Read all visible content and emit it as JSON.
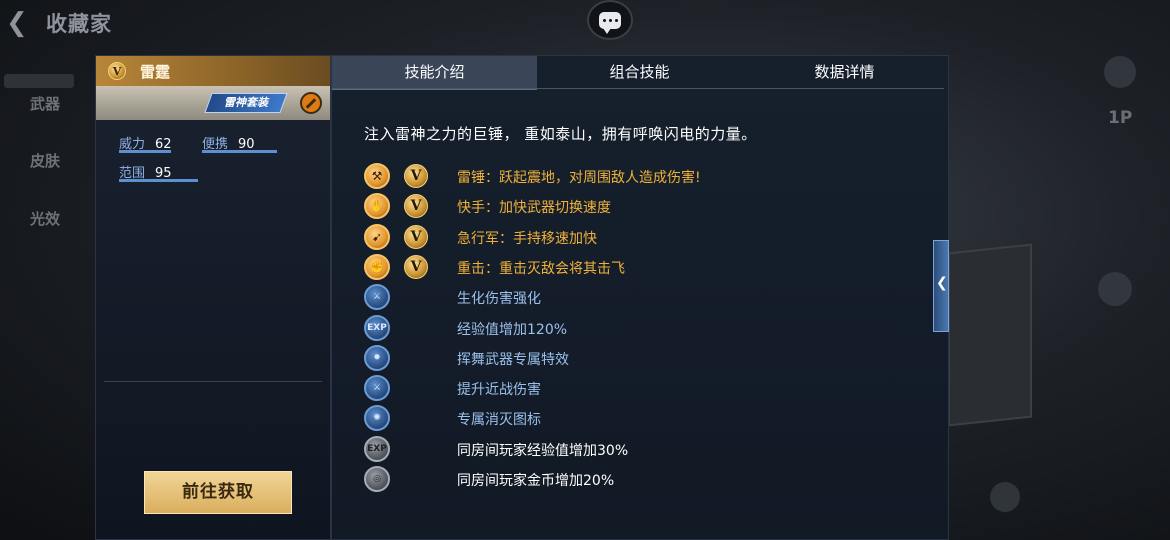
{
  "topbar": {
    "title": "收藏家",
    "back_icon": "chevron-left-icon",
    "chat_icon": "chat-bubble-icon"
  },
  "side_menu": [
    "武器",
    "皮肤",
    "光效"
  ],
  "right_hud": {
    "player_label": "1P"
  },
  "item": {
    "badge": "V",
    "name": "雷霆",
    "set_tag": "雷神套装",
    "stats": [
      {
        "label": "威力",
        "value": "62"
      },
      {
        "label": "便携",
        "value": "90"
      },
      {
        "label": "范围",
        "value": "95"
      }
    ],
    "get_button": "前往获取"
  },
  "tabs": [
    {
      "label": "技能介绍",
      "active": true
    },
    {
      "label": "组合技能",
      "active": false
    },
    {
      "label": "数据详情",
      "active": false
    }
  ],
  "description": "注入雷神之力的巨锤， 重如泰山，拥有呼唤闪电的力量。",
  "skills": [
    {
      "icon": "hammer-icon",
      "style": "gold",
      "v": "V",
      "text": "雷锤：跃起震地，对周围敌人造成伤害!",
      "color": "#f0b13a"
    },
    {
      "icon": "quick-hand-icon",
      "style": "gold",
      "v": "V",
      "text": "快手：加快武器切换速度",
      "color": "#f0b13a"
    },
    {
      "icon": "running-icon",
      "style": "gold",
      "v": "V",
      "text": "急行军：手持移速加快",
      "color": "#f0b13a"
    },
    {
      "icon": "heavy-strike-icon",
      "style": "gold",
      "v": "V",
      "text": "重击：重击灭敌会将其击飞",
      "color": "#f0b13a"
    },
    {
      "icon": "bio-damage-icon",
      "style": "blue",
      "v": "",
      "text": "生化伤害强化",
      "color": "#9bc0ec"
    },
    {
      "icon": "exp-icon",
      "style": "blue",
      "v": "",
      "text": "经验值增加120%",
      "color": "#9bc0ec"
    },
    {
      "icon": "swing-effect-icon",
      "style": "blue",
      "v": "",
      "text": "挥舞武器专属特效",
      "color": "#9bc0ec"
    },
    {
      "icon": "melee-damage-icon",
      "style": "blue",
      "v": "",
      "text": "提升近战伤害",
      "color": "#9bc0ec"
    },
    {
      "icon": "kill-icon-icon",
      "style": "blue",
      "v": "",
      "text": "专属消灭图标",
      "color": "#9bc0ec"
    },
    {
      "icon": "room-exp-icon",
      "style": "grey",
      "v": "",
      "text": "同房间玩家经验值增加30%",
      "color": "#ffffff"
    },
    {
      "icon": "room-coin-icon",
      "style": "grey",
      "v": "",
      "text": "同房间玩家金币增加20%",
      "color": "#ffffff"
    }
  ],
  "colors": {
    "gold": "#f0b13a",
    "blue": "#9bc0ec",
    "button": "#e6c27a"
  }
}
